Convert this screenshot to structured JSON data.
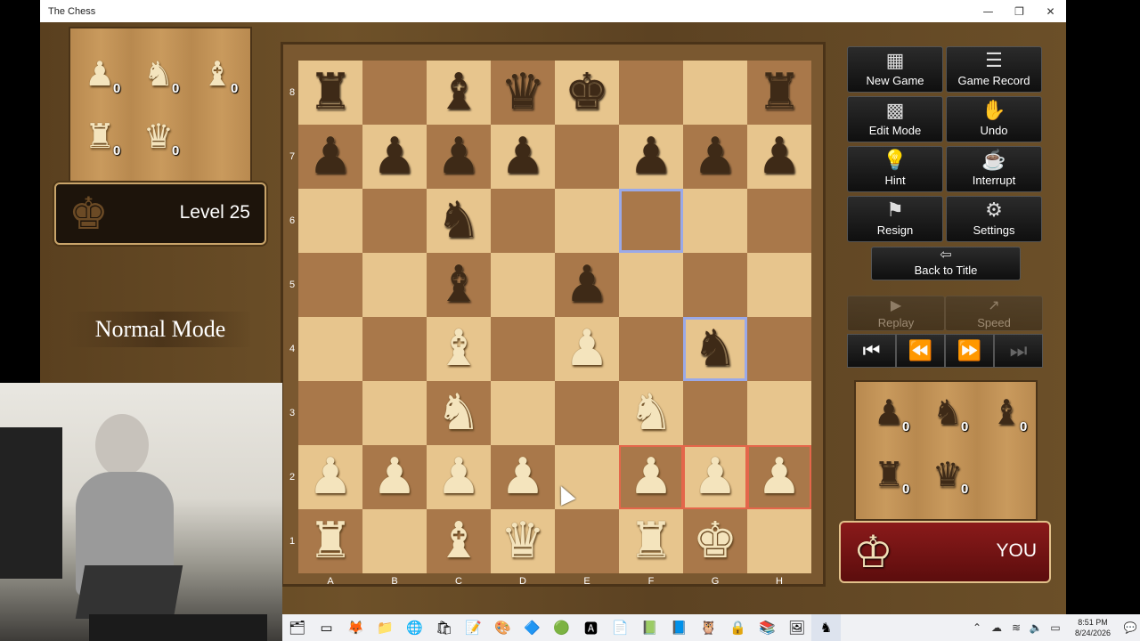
{
  "window": {
    "title": "The Chess",
    "controls": [
      "—",
      "❐",
      "✕"
    ]
  },
  "top_captured": [
    {
      "piece": "♟",
      "count": "0"
    },
    {
      "piece": "♞",
      "count": "0"
    },
    {
      "piece": "♝",
      "count": "0"
    },
    {
      "piece": "♜",
      "count": "0"
    },
    {
      "piece": "♛",
      "count": "0"
    }
  ],
  "bottom_captured": [
    {
      "piece": "♟",
      "count": "0"
    },
    {
      "piece": "♞",
      "count": "0"
    },
    {
      "piece": "♝",
      "count": "0"
    },
    {
      "piece": "♜",
      "count": "0"
    },
    {
      "piece": "♛",
      "count": "0"
    }
  ],
  "opponent": {
    "icon": "♚",
    "level": "Level 25"
  },
  "mode": "Normal Mode",
  "player": {
    "icon": "♔",
    "label": "YOU"
  },
  "board": {
    "files": [
      "A",
      "B",
      "C",
      "D",
      "E",
      "F",
      "G",
      "H"
    ],
    "ranks": [
      "8",
      "7",
      "6",
      "5",
      "4",
      "3",
      "2",
      "1"
    ],
    "rows": [
      [
        "bR",
        "",
        "bB",
        "bQ",
        "bK",
        "",
        "",
        "bR"
      ],
      [
        "bP",
        "bP",
        "bP",
        "bP",
        "",
        "bP",
        "bP",
        "bP"
      ],
      [
        "",
        "",
        "bN",
        "",
        "",
        "",
        "",
        ""
      ],
      [
        "",
        "",
        "bB",
        "",
        "bP",
        "",
        "",
        ""
      ],
      [
        "",
        "",
        "wB",
        "",
        "wP",
        "",
        "bN",
        ""
      ],
      [
        "",
        "",
        "wN",
        "",
        "",
        "wN",
        "",
        ""
      ],
      [
        "wP",
        "wP",
        "wP",
        "wP",
        "",
        "wP",
        "wP",
        "wP"
      ],
      [
        "wR",
        "",
        "wB",
        "wQ",
        "",
        "wR",
        "wK",
        ""
      ]
    ],
    "selected_squares": [
      "f6",
      "g4"
    ],
    "highlighted_squares": [
      "f2",
      "g2",
      "h2"
    ]
  },
  "buttons": [
    {
      "id": "new-game",
      "icon": "▦",
      "label": "New Game"
    },
    {
      "id": "game-record",
      "icon": "☰",
      "label": "Game Record"
    },
    {
      "id": "edit-mode",
      "icon": "▩",
      "label": "Edit Mode"
    },
    {
      "id": "undo",
      "icon": "✋",
      "label": "Undo"
    },
    {
      "id": "hint",
      "icon": "💡",
      "label": "Hint"
    },
    {
      "id": "interrupt",
      "icon": "☕",
      "label": "Interrupt"
    },
    {
      "id": "resign",
      "icon": "⚑",
      "label": "Resign"
    },
    {
      "id": "settings",
      "icon": "⚙",
      "label": "Settings"
    }
  ],
  "back_to_title": {
    "icon": "⇦",
    "label": "Back to Title"
  },
  "replay": {
    "icon": "▶",
    "label": "Replay"
  },
  "speed": {
    "icon": "↗",
    "label": "Speed"
  },
  "nav": [
    "⏮",
    "⏪",
    "⏩",
    "⏭"
  ],
  "taskbar": {
    "icons": [
      "🗂",
      "▭",
      "🦊",
      "📁",
      "🌐",
      "🛍",
      "📝",
      "🎨",
      "🔷",
      "🟢",
      "🅰",
      "📄",
      "📗",
      "📘",
      "🦉",
      "🔒",
      "📚",
      "🖼",
      "♞"
    ],
    "time": "8:51 PM",
    "date": "8/24/2026"
  }
}
